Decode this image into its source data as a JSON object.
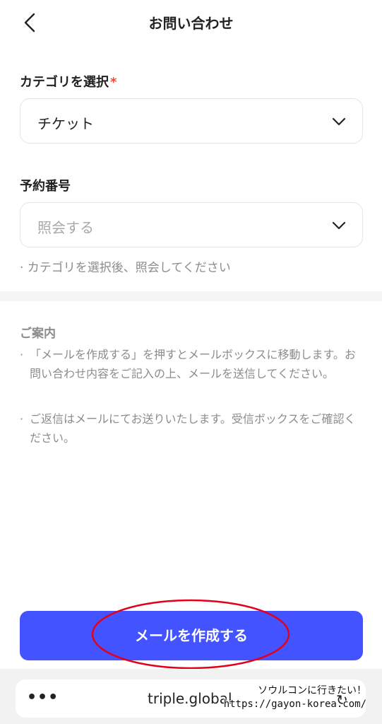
{
  "header": {
    "title": "お問い合わせ",
    "back_icon": "chevron-left-icon"
  },
  "category": {
    "label": "カテゴリを選択",
    "required_mark": "*",
    "selected_value": "チケット",
    "dropdown_icon": "chevron-down-icon"
  },
  "reservation": {
    "label": "予約番号",
    "placeholder": "照会する",
    "dropdown_icon": "chevron-down-icon",
    "hint": "· カテゴリを選択後、照会してください"
  },
  "notice": {
    "title": "ご案内",
    "items": [
      "「メールを作成する」を押すとメールボックスに移動します。お問い合わせ内容をご記入の上、メールを送信してください。",
      "ご返信はメールにてお送りいたします。受信ボックスをご確認ください。"
    ]
  },
  "primary_button": {
    "label": "メールを作成する"
  },
  "browser_bar": {
    "more_label": "•••",
    "url": "triple.global",
    "reload_icon": "reload-icon"
  },
  "watermark": {
    "line1": "ソウルコンに行きたい！",
    "line2": "https://gayon-korea.com/"
  },
  "colors": {
    "accent": "#4353ff",
    "required": "#e74c3c",
    "annotation": "#e3001b"
  }
}
